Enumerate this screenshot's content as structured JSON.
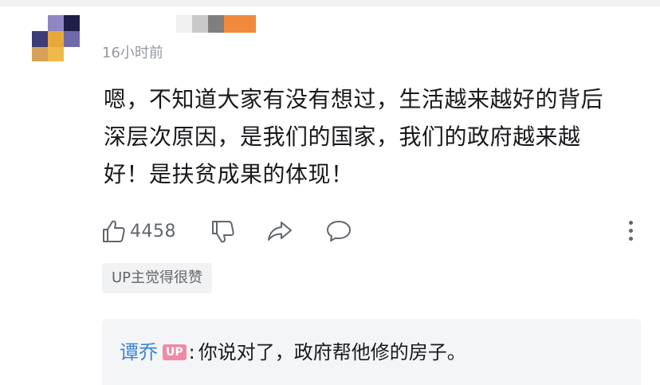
{
  "comment": {
    "timestamp": "16小时前",
    "text": "嗯，不知道大家有没有想过，生活越来越好的背后\n深层次原因，是我们的国家，我们的政府越来越\n好！是扶贫成果的体现！",
    "like_count": "4458"
  },
  "icons": {
    "like": "thumbs-up-icon",
    "dislike": "thumbs-down-icon",
    "share": "share-icon",
    "reply": "comment-bubble-icon",
    "more": "more-vertical-icon"
  },
  "up_liked_label": "UP主觉得很赞",
  "reply": {
    "user": "谭乔",
    "badge": "UP",
    "colon": ":",
    "content": "你说对了，政府帮他修的房子。"
  },
  "colors": {
    "link_blue": "#3a84d3",
    "badge_pink": "#ef8aa6",
    "secondary_text": "#9499a0",
    "reply_bg": "#f4f5f7"
  }
}
